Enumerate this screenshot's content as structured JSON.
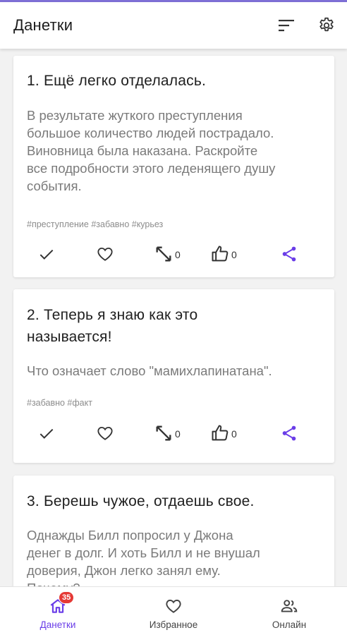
{
  "app": {
    "title": "Данетки"
  },
  "appbar": {
    "sort_icon": "sort-icon",
    "settings_icon": "gear-icon"
  },
  "cards": [
    {
      "title": "1. Ещё легко отделалась.",
      "description_lines": [
        "В результате жуткого преступления",
        "большое количество людей пострадало.",
        "Виновница была наказана. Раскройте",
        "все подробности этого леденящего душу",
        "события."
      ],
      "tags": "#преступление #забавно #курьез",
      "resize_count": "0",
      "like_count": "0"
    },
    {
      "title_lines": [
        "2. Теперь я знаю как это",
        "называется!"
      ],
      "description_lines": [
        "Что означает слово \"мамихлапинатана\"."
      ],
      "tags": "#забавно #факт",
      "resize_count": "0",
      "like_count": "0"
    },
    {
      "title": "3. Берешь чужое, отдаешь свое.",
      "description_lines": [
        "Однажды Билл попросил у Джона",
        "денег в долг. И хоть Билл и не внушал",
        "доверия, Джон легко занял ему.",
        "Почему?"
      ]
    }
  ],
  "bottom_nav": {
    "items": [
      {
        "label": "Данетки",
        "icon": "home-icon",
        "badge": "35",
        "active": true
      },
      {
        "label": "Избранное",
        "icon": "heart-icon"
      },
      {
        "label": "Онлайн",
        "icon": "people-icon"
      }
    ]
  },
  "colors": {
    "accent": "#6a3de8",
    "badge": "#e53935"
  }
}
